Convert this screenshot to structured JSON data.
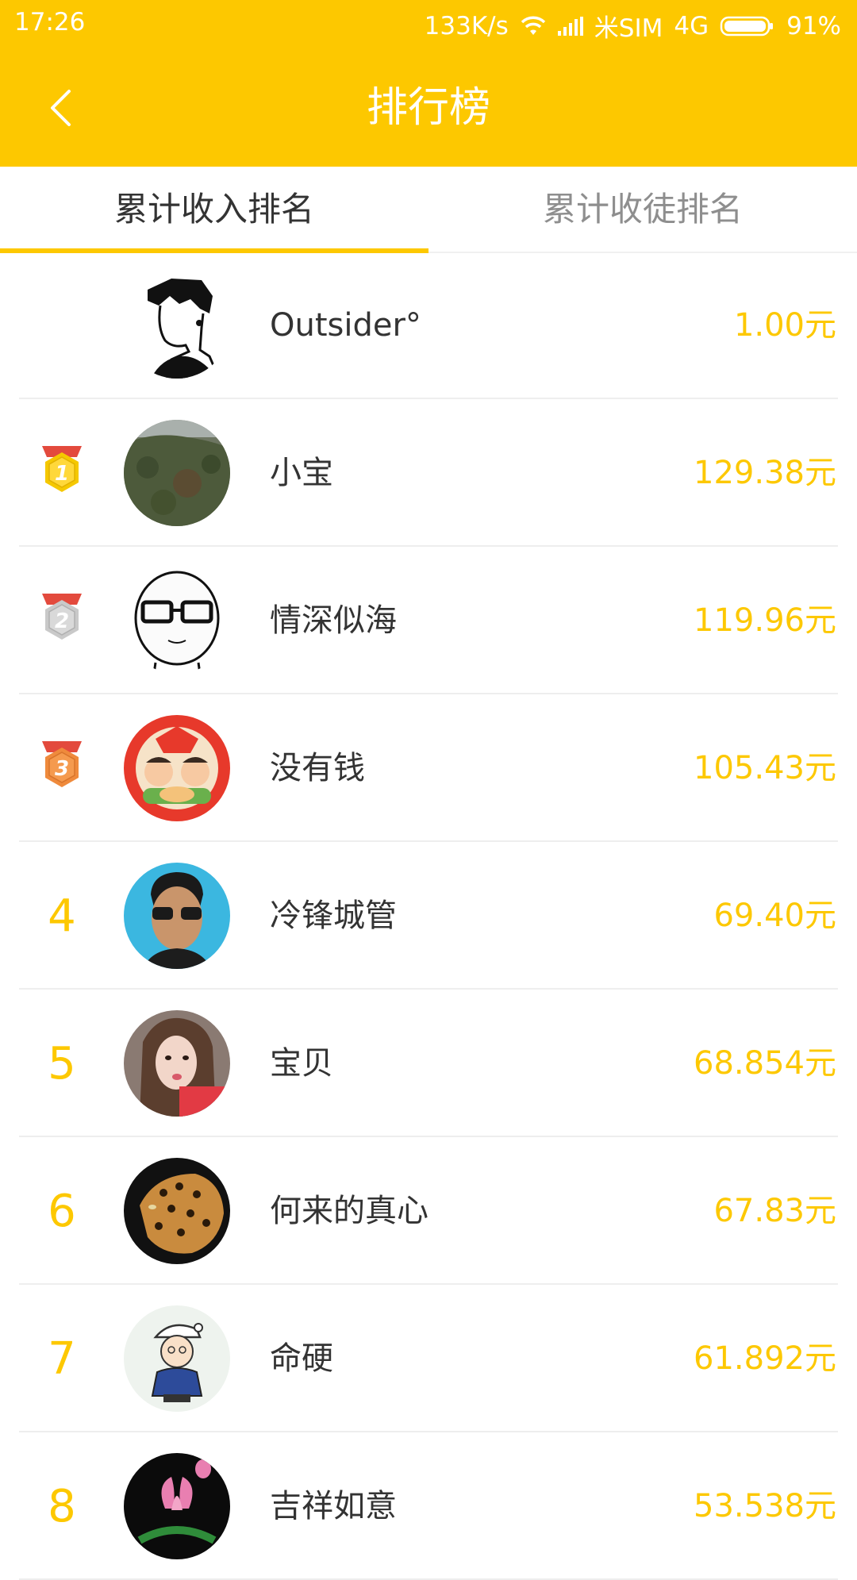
{
  "status_bar": {
    "time": "17:26",
    "speed": "133K/s",
    "carrier": "米SIM",
    "network": "4G",
    "battery": "91%"
  },
  "header": {
    "title": "排行榜"
  },
  "tabs": [
    {
      "label": "累计收入排名",
      "active": true
    },
    {
      "label": "累计收徒排名",
      "active": false
    }
  ],
  "me": {
    "name": "Outsider°",
    "amount": "1.00元"
  },
  "ranking": [
    {
      "rank": "1",
      "name": "小宝",
      "amount": "129.38元",
      "medal": "gold"
    },
    {
      "rank": "2",
      "name": "情深似海",
      "amount": "119.96元",
      "medal": "silver"
    },
    {
      "rank": "3",
      "name": "没有钱",
      "amount": "105.43元",
      "medal": "bronze"
    },
    {
      "rank": "4",
      "name": "冷锋城管",
      "amount": "69.40元"
    },
    {
      "rank": "5",
      "name": "宝贝",
      "amount": "68.854元"
    },
    {
      "rank": "6",
      "name": "何来的真心",
      "amount": "67.83元"
    },
    {
      "rank": "7",
      "name": "命硬",
      "amount": "61.892元"
    },
    {
      "rank": "8",
      "name": "吉祥如意",
      "amount": "53.538元"
    }
  ],
  "colors": {
    "accent": "#FDC800",
    "text_primary": "#333333",
    "text_secondary": "#8e8e8e",
    "divider": "#eeeeee",
    "medal_gold": "#F5C800",
    "medal_silver": "#C9C9C9",
    "medal_bronze": "#EF8A3C",
    "medal_ribbon": "#E34A3D"
  }
}
